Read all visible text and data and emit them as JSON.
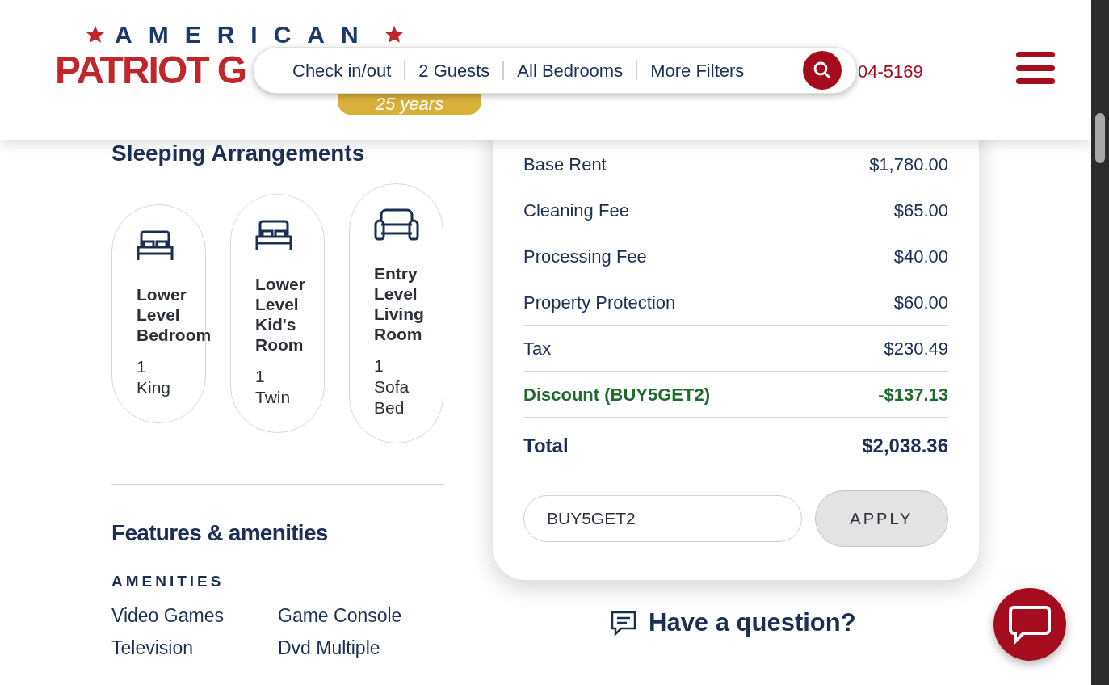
{
  "header": {
    "logo": {
      "top": "AMERICAN",
      "main": "PATRIOT G",
      "ribbon": "25 years"
    },
    "search_bar": {
      "filters": [
        "Check in/out",
        "2 Guests",
        "All Bedrooms",
        "More Filters"
      ]
    },
    "phone": "04-5169"
  },
  "sleeping": {
    "title": "Sleeping Arrangements",
    "rooms": [
      {
        "kind": "bed",
        "name": "Lower Level Bedroom",
        "count": "1",
        "bed": "King"
      },
      {
        "kind": "bed",
        "name": "Lower Level Kid's Room",
        "count": "1",
        "bed": "Twin"
      },
      {
        "kind": "sofa",
        "name": "Entry Level Living Room",
        "count": "1",
        "bed": "Sofa Bed"
      }
    ]
  },
  "features": {
    "title": "Features & amenities",
    "section": "AMENITIES",
    "items": [
      "Video Games",
      "Game Console",
      "Television",
      "Dvd Multiple"
    ]
  },
  "price": {
    "lines": [
      {
        "kind": "fee",
        "label": "Base Rent",
        "amount": "$1,780.00"
      },
      {
        "kind": "fee",
        "label": "Cleaning Fee",
        "amount": "$65.00"
      },
      {
        "kind": "fee",
        "label": "Processing Fee",
        "amount": "$40.00"
      },
      {
        "kind": "fee",
        "label": "Property Protection",
        "amount": "$60.00"
      },
      {
        "kind": "fee",
        "label": "Tax",
        "amount": "$230.49"
      },
      {
        "kind": "discount",
        "label": "Discount (BUY5GET2)",
        "amount": "-$137.13"
      }
    ],
    "total": {
      "label": "Total",
      "amount": "$2,038.36"
    },
    "coupon": {
      "value": "BUY5GET2",
      "button": "APPLY"
    }
  },
  "question": "Have a question?"
}
